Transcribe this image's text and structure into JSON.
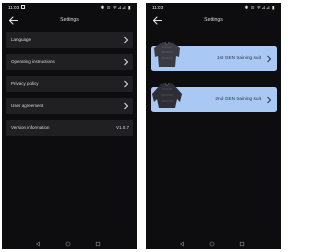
{
  "left_screen": {
    "status": {
      "time": "11:03",
      "icons": "✱ ⊙ ᯤ⊿⊿ ▮"
    },
    "header": {
      "title": "Settings"
    },
    "menu": [
      {
        "label": "Language"
      },
      {
        "label": "Operating instructions"
      },
      {
        "label": "Privacy policy"
      },
      {
        "label": "User agreement"
      },
      {
        "label": "Version information",
        "value": "V1.0.7"
      }
    ]
  },
  "right_screen": {
    "status": {
      "time": "11:03",
      "icons": "✱ ⊙ ᯤ⊿⊿ ▮"
    },
    "header": {
      "title": "Settings"
    },
    "suits": [
      {
        "label": "1st GEN training suit"
      },
      {
        "label": "2nd GEN training suit"
      }
    ]
  },
  "colors": {
    "screen_bg": "#0d0d0f",
    "row_bg": "#202023",
    "card_bg": "#aac8f4",
    "text": "#d6d6d6"
  },
  "icons": [
    "back-arrow-icon",
    "chevron-right-icon",
    "nav-back-icon",
    "nav-home-icon",
    "nav-recent-icon"
  ]
}
